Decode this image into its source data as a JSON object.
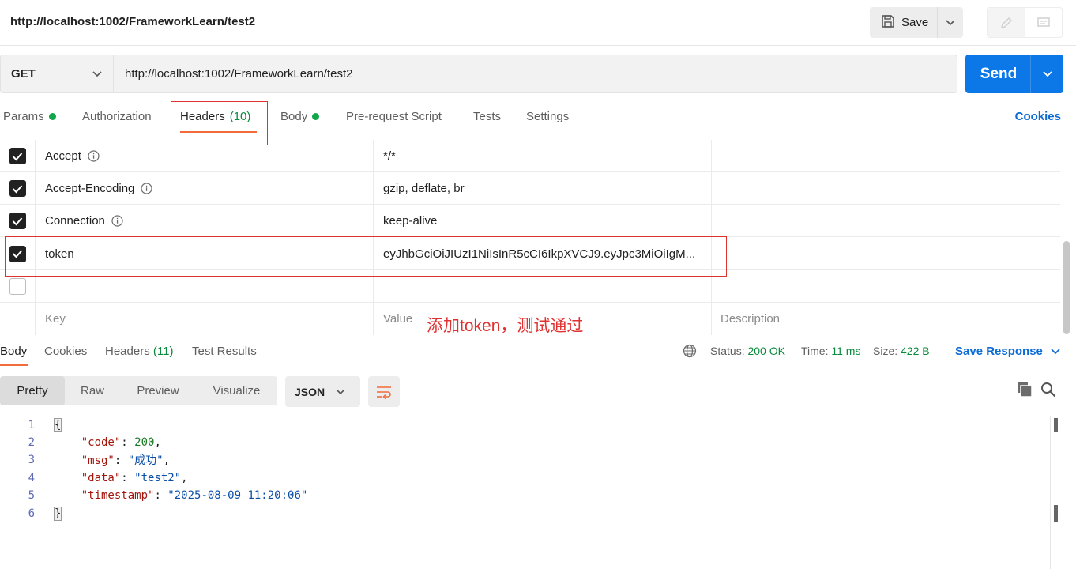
{
  "header": {
    "title": "http://localhost:1002/FrameworkLearn/test2",
    "save_label": "Save"
  },
  "request": {
    "method": "GET",
    "url": "http://localhost:1002/FrameworkLearn/test2",
    "send_label": "Send"
  },
  "request_tabs": {
    "params": "Params",
    "authorization": "Authorization",
    "headers": "Headers",
    "headers_count": "(10)",
    "body": "Body",
    "prerequest": "Pre-request Script",
    "tests": "Tests",
    "settings": "Settings",
    "cookies": "Cookies"
  },
  "headers_table": {
    "rows": [
      {
        "key": "Accept",
        "value": "*/*",
        "checked": true
      },
      {
        "key": "Accept-Encoding",
        "value": "gzip, deflate, br",
        "checked": true
      },
      {
        "key": "Connection",
        "value": "keep-alive",
        "checked": true
      },
      {
        "key": "token",
        "value": "eyJhbGciOiJIUzI1NiIsInR5cCI6IkpXVCJ9.eyJpc3MiOiIgM...",
        "checked": true
      }
    ],
    "placeholder_key": "Key",
    "placeholder_value": "Value",
    "placeholder_desc": "Description"
  },
  "annotation": "添加token，测试通过",
  "response_tabs": {
    "body": "Body",
    "cookies": "Cookies",
    "headers": "Headers",
    "headers_count": "(11)",
    "test_results": "Test Results"
  },
  "response_meta": {
    "status_label": "Status:",
    "status_value": "200 OK",
    "time_label": "Time:",
    "time_value": "11 ms",
    "size_label": "Size:",
    "size_value": "422 B",
    "save_response": "Save Response"
  },
  "view_modes": {
    "pretty": "Pretty",
    "raw": "Raw",
    "preview": "Preview",
    "visualize": "Visualize",
    "format": "JSON"
  },
  "code": {
    "line_numbers": [
      "1",
      "2",
      "3",
      "4",
      "5",
      "6"
    ],
    "open_brace": "{",
    "close_brace": "}",
    "entries": [
      {
        "key": "\"code\"",
        "value": "200",
        "type": "number",
        "comma": ","
      },
      {
        "key": "\"msg\"",
        "value": "\"成功\"",
        "type": "string",
        "comma": ","
      },
      {
        "key": "\"data\"",
        "value": "\"test2\"",
        "type": "string",
        "comma": ","
      },
      {
        "key": "\"timestamp\"",
        "value": "\"2025-08-09 11:20:06\"",
        "type": "string",
        "comma": ""
      }
    ],
    "colon": ": "
  },
  "colors": {
    "accent_orange": "#f26b3a",
    "send_blue": "#0c78e8",
    "link_blue": "#0c6cd6",
    "status_green": "#0a8a3c",
    "highlight_red": "#e03131"
  }
}
